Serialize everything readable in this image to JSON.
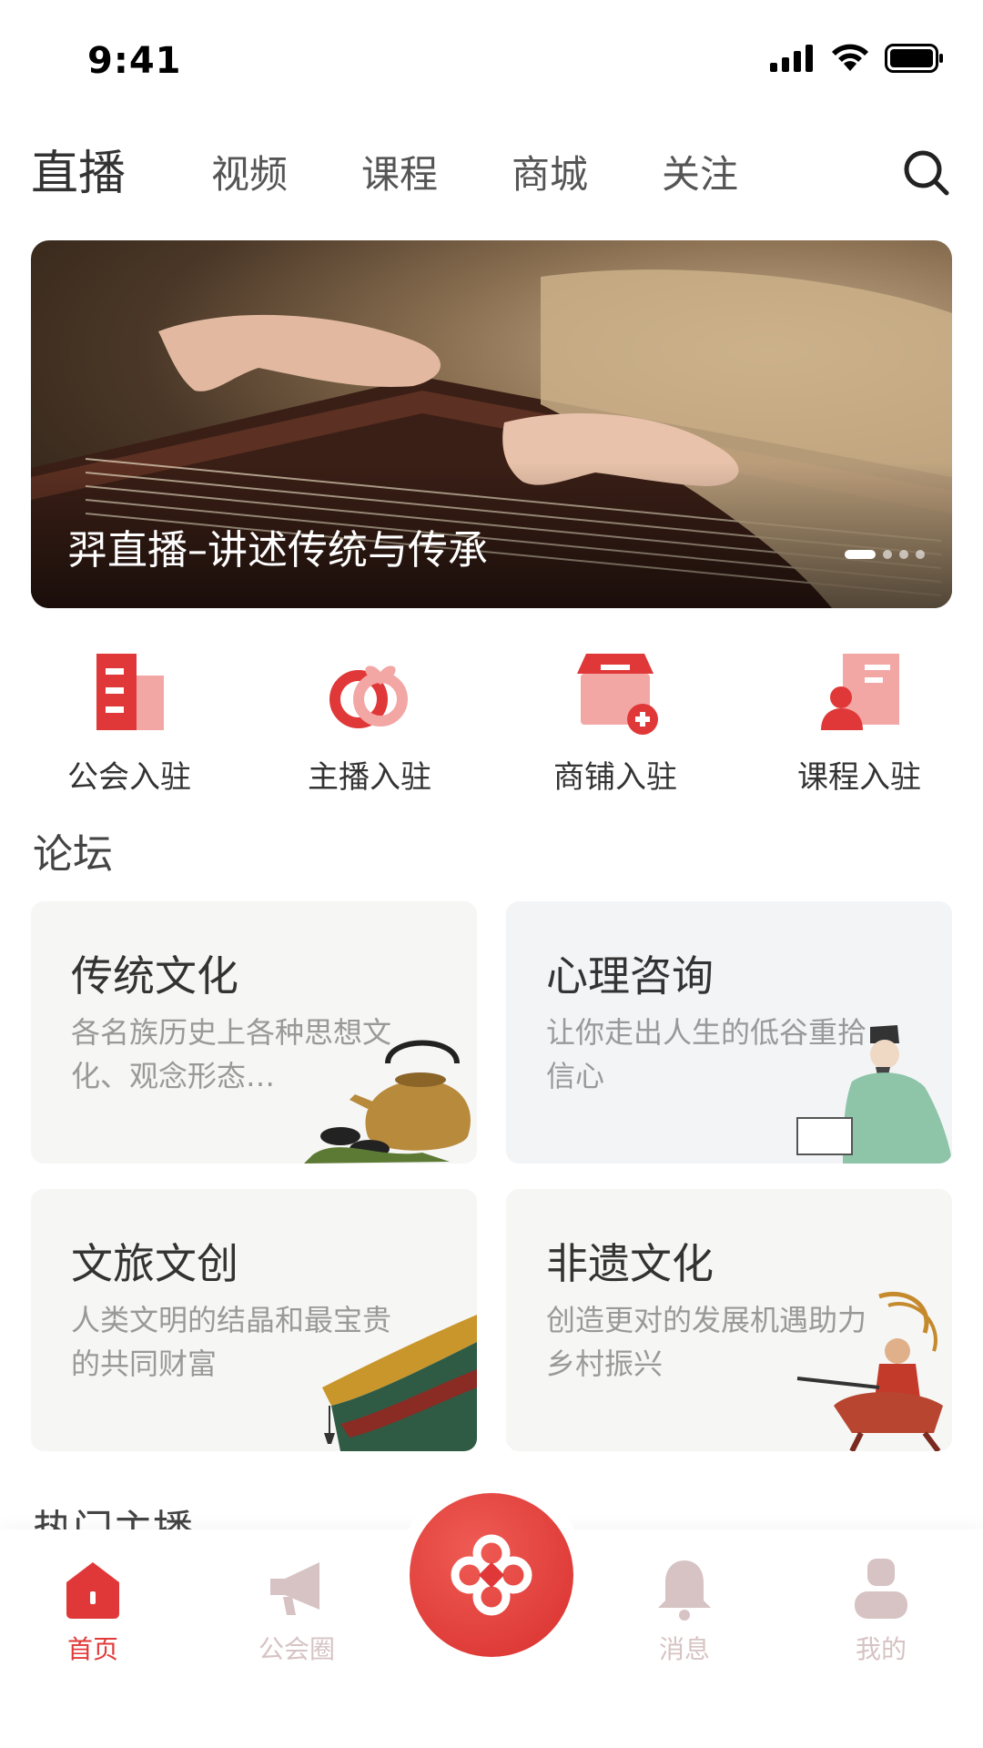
{
  "status_bar": {
    "time": "9:41"
  },
  "nav": {
    "tabs": [
      "直播",
      "视频",
      "课程",
      "商城",
      "关注"
    ],
    "active": "直播"
  },
  "banner": {
    "caption": "羿直播–讲述传统与传承",
    "page_count": 4,
    "current_page": 1
  },
  "entries": [
    {
      "label": "公会入驻",
      "icon": "building-icon"
    },
    {
      "label": "主播入驻",
      "icon": "linked-rings-icon"
    },
    {
      "label": "商铺入驻",
      "icon": "shop-add-icon"
    },
    {
      "label": "课程入驻",
      "icon": "teacher-board-icon"
    }
  ],
  "forum": {
    "title": "论坛",
    "cards": [
      {
        "title": "传统文化",
        "desc": "各名族历史上各种思想文化、观念形态…",
        "art": "teapot-icon"
      },
      {
        "title": "心理咨询",
        "desc": "让你走出人生的低谷重拾信心",
        "art": "scholar-icon"
      },
      {
        "title": "文旅文创",
        "desc": "人类文明的结晶和最宝贵的共同财富",
        "art": "palace-eave-icon"
      },
      {
        "title": "非遗文化",
        "desc": "创造更对的发展机遇助力乡村振兴",
        "art": "opera-warrior-icon"
      }
    ]
  },
  "hot_anchors": {
    "title": "热门主播"
  },
  "tab_bar": {
    "items": [
      {
        "label": "首页",
        "icon": "home-icon",
        "active": true
      },
      {
        "label": "公会圈",
        "icon": "megaphone-icon",
        "active": false
      },
      {
        "label": "消息",
        "icon": "bell-icon",
        "active": false
      },
      {
        "label": "我的",
        "icon": "person-icon",
        "active": false
      }
    ],
    "center_icon": "chinese-knot-icon"
  },
  "colors": {
    "accent": "#e23a3a",
    "inactive_tab": "#d7c3c3"
  }
}
